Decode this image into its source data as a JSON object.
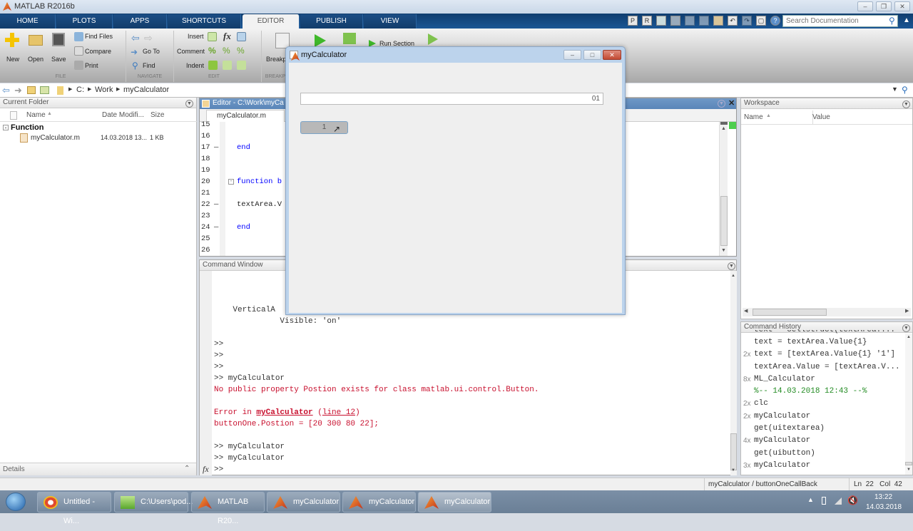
{
  "app": {
    "title": "MATLAB R2016b",
    "window_controls": [
      "minimize",
      "restore",
      "close"
    ]
  },
  "tabs": [
    {
      "label": "HOME",
      "active": false
    },
    {
      "label": "PLOTS",
      "active": false
    },
    {
      "label": "APPS",
      "active": false
    },
    {
      "label": "SHORTCUTS",
      "active": false
    },
    {
      "label": "EDITOR",
      "active": true
    },
    {
      "label": "PUBLISH",
      "active": false
    },
    {
      "label": "VIEW",
      "active": false
    }
  ],
  "quick_access": [
    "P",
    "R"
  ],
  "search": {
    "placeholder": "Search Documentation"
  },
  "ribbon": {
    "file": {
      "group": "FILE",
      "new": "New",
      "open": "Open",
      "save": "Save",
      "find_files": "Find Files",
      "compare": "Compare",
      "print": "Print"
    },
    "navigate": {
      "group": "NAVIGATE",
      "go_to": "Go To",
      "find": "Find"
    },
    "edit": {
      "group": "EDIT",
      "insert": "Insert",
      "comment": "Comment",
      "indent": "Indent",
      "fx": "fx"
    },
    "breakpoints": {
      "group": "BREAKP",
      "label": "Breakp"
    },
    "run": {
      "run_section": "Run Section"
    }
  },
  "address": {
    "path": [
      "C:",
      "Work",
      "myCalculator"
    ]
  },
  "current_folder": {
    "title": "Current Folder",
    "columns": [
      "Name",
      "Date Modifi...",
      "Size"
    ],
    "group": "Function",
    "files": [
      {
        "name": "myCalculator.m",
        "date": "14.03.2018 13...",
        "size": "1 KB"
      }
    ],
    "details": "Details"
  },
  "editor": {
    "title": "Editor - C:\\Work\\myCa",
    "tab": "myCalculator.m",
    "lines": [
      {
        "n": "15",
        "dash": "",
        "code": ""
      },
      {
        "n": "16",
        "dash": "",
        "code": ""
      },
      {
        "n": "17",
        "dash": "—",
        "code": "end",
        "kw": true
      },
      {
        "n": "18",
        "dash": "",
        "code": ""
      },
      {
        "n": "19",
        "dash": "",
        "code": ""
      },
      {
        "n": "20",
        "dash": "",
        "code": "function b",
        "kw": true
      },
      {
        "n": "21",
        "dash": "",
        "code": ""
      },
      {
        "n": "22",
        "dash": "—",
        "code": "textArea.V"
      },
      {
        "n": "23",
        "dash": "",
        "code": ""
      },
      {
        "n": "24",
        "dash": "—",
        "code": "end",
        "kw": true
      },
      {
        "n": "25",
        "dash": "",
        "code": ""
      },
      {
        "n": "26",
        "dash": "",
        "code": ""
      }
    ]
  },
  "command_window": {
    "title": "Command Window",
    "lines": [
      {
        "text": "    VerticalA",
        "type": "normal"
      },
      {
        "text": "              Visible: 'on'",
        "type": "normal"
      },
      {
        "text": "",
        "type": "normal"
      },
      {
        "text": ">>",
        "type": "normal"
      },
      {
        "text": ">>",
        "type": "normal"
      },
      {
        "text": ">>",
        "type": "normal"
      },
      {
        "text": ">> myCalculator",
        "type": "normal"
      },
      {
        "text": "No public property Postion exists for class matlab.ui.control.Button.",
        "type": "error"
      },
      {
        "text": "",
        "type": "normal"
      }
    ],
    "error_in": {
      "prefix": "Error in ",
      "func": "myCalculator",
      "line": "line 12"
    },
    "error_code": "buttonOne.Postion = [20 300 80 22];",
    "after": [
      ">> myCalculator",
      ">> myCalculator"
    ],
    "prompt": ">>",
    "fx": "fx"
  },
  "workspace": {
    "title": "Workspace",
    "columns": [
      "Name",
      "Value"
    ]
  },
  "history": {
    "title": "Command History",
    "items": [
      {
        "count": "",
        "text": "text = cellstruct(textArea....",
        "type": "cut"
      },
      {
        "count": "",
        "text": "text = textArea.Value{1}",
        "type": "normal"
      },
      {
        "count": "2x",
        "text": "text = [textArea.Value{1} '1']",
        "type": "normal"
      },
      {
        "count": "",
        "text": "textArea.Value = [textArea.V...",
        "type": "normal"
      },
      {
        "count": "8x",
        "text": "ML_Calculator",
        "type": "normal"
      },
      {
        "count": "",
        "text": "%-- 14.03.2018 12:43 --%",
        "type": "comment"
      },
      {
        "count": "2x",
        "text": "clc",
        "type": "normal"
      },
      {
        "count": "2x",
        "text": "myCalculator",
        "type": "normal"
      },
      {
        "count": "",
        "text": "get(uitextarea)",
        "type": "normal"
      },
      {
        "count": "4x",
        "text": "myCalculator",
        "type": "normal"
      },
      {
        "count": "",
        "text": "get(uibutton)",
        "type": "normal"
      },
      {
        "count": "3x",
        "text": "myCalculator",
        "type": "normal"
      }
    ]
  },
  "status": {
    "context": "myCalculator / buttonOneCallBack",
    "ln_label": "Ln",
    "ln": "22",
    "col_label": "Col",
    "col": "42"
  },
  "dialog": {
    "title": "myCalculator",
    "display_value": "01",
    "button_label": "1"
  },
  "taskbar": {
    "items": [
      {
        "label": "Untitled - Wi...",
        "icon": "chrome-icon"
      },
      {
        "label": "C:\\Users\\pod...",
        "icon": "notepad-icon"
      },
      {
        "label": "MATLAB R20...",
        "icon": "matlab-icon"
      },
      {
        "label": "myCalculator",
        "icon": "matlab-icon"
      },
      {
        "label": "myCalculator",
        "icon": "matlab-icon"
      },
      {
        "label": "myCalculator",
        "icon": "matlab-icon"
      }
    ],
    "time": "13:22",
    "date": "14.03.2018"
  },
  "colors": {
    "error": "#c8102e",
    "keyword": "#0000ff",
    "comment": "#228b22",
    "tab_bar": "#1b5694"
  }
}
